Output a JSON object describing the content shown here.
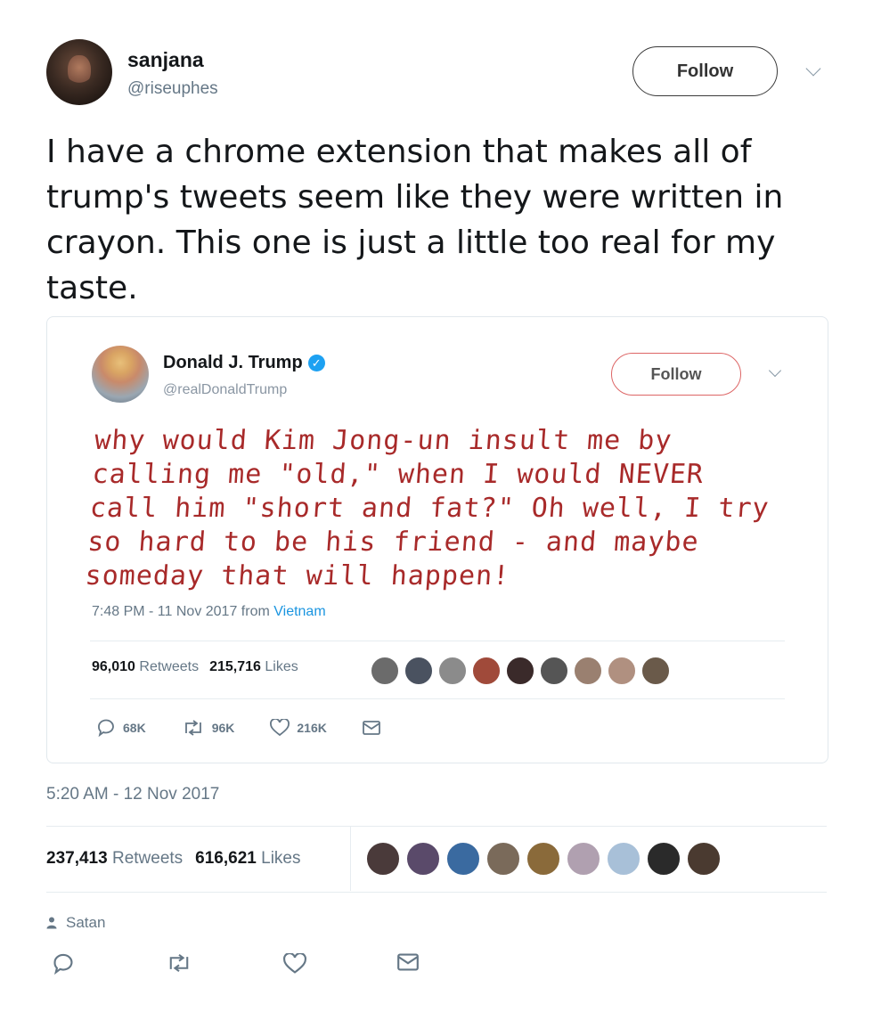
{
  "header": {
    "display_name": "sanjana",
    "handle": "@riseuphes",
    "follow_label": "Follow"
  },
  "tweet": {
    "text": "I have a chrome extension that makes all of trump's tweets seem like they were written in crayon. This one is just a little too real for my taste.",
    "timestamp": "5:20 AM - 12 Nov 2017",
    "retweets_count": "237,413",
    "retweets_label": "Retweets",
    "likes_count": "616,621",
    "likes_label": "Likes",
    "location": "Satan"
  },
  "quoted": {
    "display_name": "Donald J. Trump",
    "handle": "@realDonaldTrump",
    "follow_label": "Follow",
    "text": "why would Kim Jong-un insult me by calling me \"old,\" when I would NEVER call him \"short and fat?\" Oh well, I try so hard to be his friend - and maybe someday that will happen!",
    "time": "7:48 PM - 11 Nov 2017 from",
    "place": "Vietnam",
    "retweets_count": "96,010",
    "retweets_label": "Retweets",
    "likes_count": "215,716",
    "likes_label": "Likes",
    "reply_count": "68K",
    "retweet_action_count": "96K",
    "like_action_count": "216K"
  },
  "icons": [
    "verified-badge-icon",
    "chevron-down-icon",
    "reply-icon",
    "retweet-icon",
    "heart-icon",
    "mail-icon",
    "person-icon"
  ],
  "colors": {
    "link_blue": "#1b95e0",
    "crayon_red": "#a82a2a",
    "muted_gray": "#657786"
  }
}
